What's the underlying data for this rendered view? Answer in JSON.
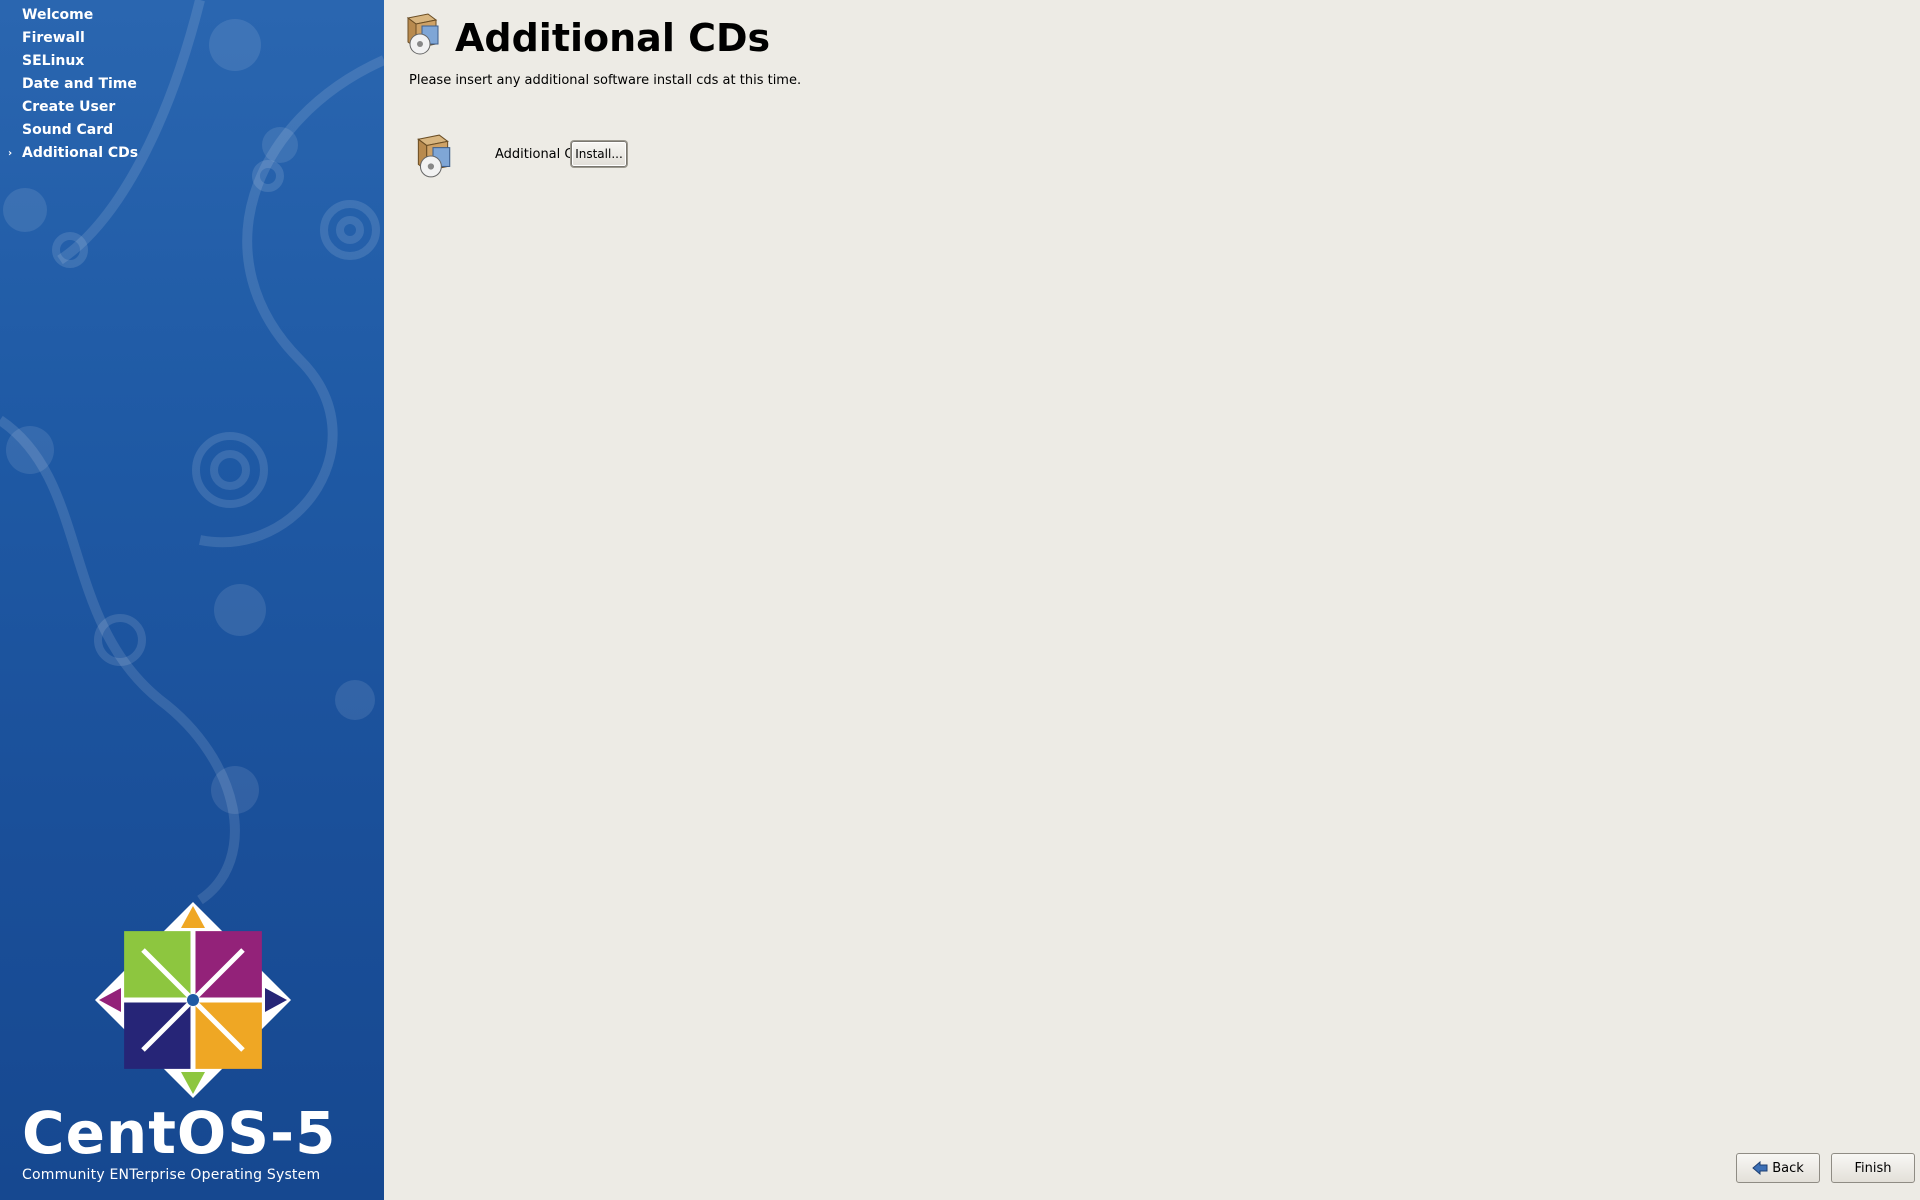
{
  "sidebar": {
    "items": [
      {
        "label": "Welcome",
        "current": false
      },
      {
        "label": "Firewall",
        "current": false
      },
      {
        "label": "SELinux",
        "current": false
      },
      {
        "label": "Date and Time",
        "current": false
      },
      {
        "label": "Create User",
        "current": false
      },
      {
        "label": "Sound Card",
        "current": false
      },
      {
        "label": "Additional CDs",
        "current": true
      }
    ],
    "current_marker": "›",
    "brand": "CentOS-5",
    "tagline": "Community ENTerprise Operating System"
  },
  "page": {
    "title": "Additional CDs",
    "description": "Please insert any additional software install cds at this time.",
    "icon": "package-cd-icon"
  },
  "cd_row": {
    "label": "Additional CDs",
    "button_label": "Install...",
    "icon": "package-cd-icon"
  },
  "footer": {
    "back_label": "Back",
    "finish_label": "Finish"
  },
  "colors": {
    "sidebar_bg": "#1f5aa5",
    "main_bg": "#edebe5",
    "logo_green": "#8dc63f",
    "logo_purple": "#932279",
    "logo_orange": "#efa724",
    "logo_navy": "#262577"
  }
}
